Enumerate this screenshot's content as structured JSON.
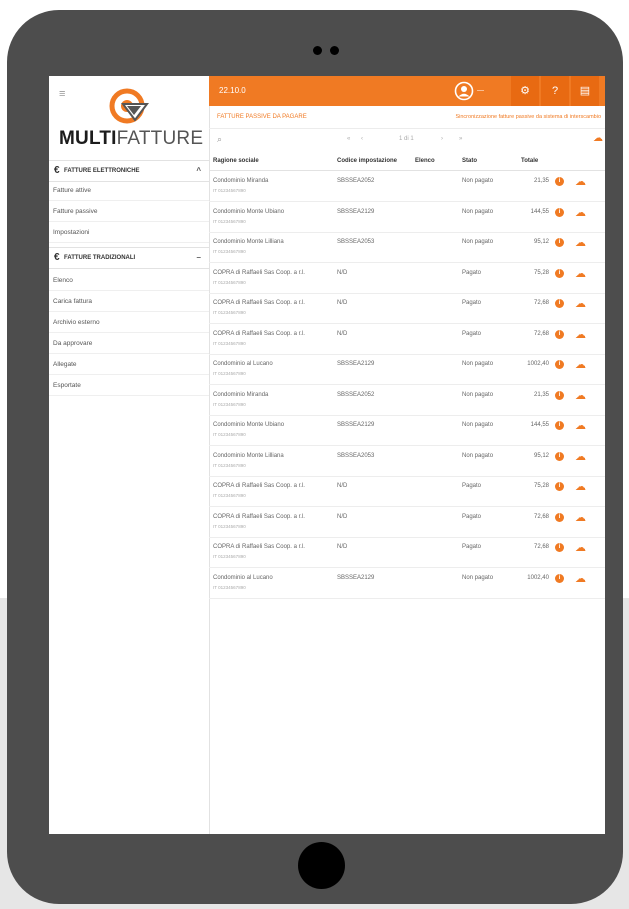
{
  "app": {
    "logo_bold": "MULTI",
    "logo_light": "FATTURE",
    "title": "22.10.0",
    "user": "—",
    "colors": {
      "accent": "#f07a23",
      "accent_dark": "#e86a12",
      "frame": "#4d4d4d"
    }
  },
  "topbar": {
    "icons": [
      "user-circle-icon",
      "gear-icon",
      "help-icon",
      "document-icon"
    ],
    "settings_glyph": "⚙",
    "help_glyph": "?",
    "doc_glyph": "▤"
  },
  "sidebar": {
    "menu_glyph": "≡",
    "sections": [
      {
        "title": "FATTURE ELETTRONICHE",
        "items": [
          "Fatture attive",
          "Fatture passive",
          "Impostazioni"
        ]
      },
      {
        "title": "FATTURE TRADIZIONALI",
        "items": [
          "Elenco",
          "Carica fattura",
          "Archivio esterno",
          "Da approvare",
          "Allegate",
          "Esportate"
        ]
      }
    ]
  },
  "main": {
    "breadcrumb": "FATTURE PASSIVE DA PAGARE",
    "header_right": "Sincronizzazione fatture passive da sistema di interscambio",
    "search_glyph": "⌕",
    "pager": [
      "«",
      "‹",
      "1 di 1",
      "›",
      "»"
    ],
    "columns": [
      "Ragione sociale",
      "Codice impostazione",
      "Elenco",
      "Stato",
      "Totale"
    ],
    "rows": [
      {
        "name": "Condominio Miranda",
        "sub": "IT 01234567890",
        "code": "SBSSEA2052",
        "stato": "Non pagato",
        "tot": "21,35"
      },
      {
        "name": "Condominio Monte Ubiano",
        "sub": "IT 01234567890",
        "code": "SBSSEA2129",
        "stato": "Non pagato",
        "tot": "144,55"
      },
      {
        "name": "Condominio Monte Lilliana",
        "sub": "IT 01234567890",
        "code": "SBSSEA2053",
        "stato": "Non pagato",
        "tot": "95,12"
      },
      {
        "name": "COPRA di Raffaeli Sas Coop. a r.l.",
        "sub": "IT 01234567890",
        "code": "N/D",
        "stato": "Pagato",
        "tot": "75,28"
      },
      {
        "name": "COPRA di Raffaeli Sas Coop. a r.l.",
        "sub": "IT 01234567890",
        "code": "N/D",
        "stato": "Pagato",
        "tot": "72,68"
      },
      {
        "name": "COPRA di Raffaeli Sas Coop. a r.l.",
        "sub": "IT 01234567890",
        "code": "N/D",
        "stato": "Pagato",
        "tot": "72,68"
      },
      {
        "name": "Condominio al Lucano",
        "sub": "IT 01234567890",
        "code": "SBSSEA2129",
        "stato": "Non pagato",
        "tot": "1002,40"
      },
      {
        "name": "Condominio Miranda",
        "sub": "IT 01234567890",
        "code": "SBSSEA2052",
        "stato": "Non pagato",
        "tot": "21,35"
      },
      {
        "name": "Condominio Monte Ubiano",
        "sub": "IT 01234567890",
        "code": "SBSSEA2129",
        "stato": "Non pagato",
        "tot": "144,55"
      },
      {
        "name": "Condominio Monte Lilliana",
        "sub": "IT 01234567890",
        "code": "SBSSEA2053",
        "stato": "Non pagato",
        "tot": "95,12"
      },
      {
        "name": "COPRA di Raffaeli Sas Coop. a r.l.",
        "sub": "IT 01234567890",
        "code": "N/D",
        "stato": "Pagato",
        "tot": "75,28"
      },
      {
        "name": "COPRA di Raffaeli Sas Coop. a r.l.",
        "sub": "IT 01234567890",
        "code": "N/D",
        "stato": "Pagato",
        "tot": "72,68"
      },
      {
        "name": "COPRA di Raffaeli Sas Coop. a r.l.",
        "sub": "IT 01234567890",
        "code": "N/D",
        "stato": "Pagato",
        "tot": "72,68"
      },
      {
        "name": "Condominio al Lucano",
        "sub": "IT 01234567890",
        "code": "SBSSEA2129",
        "stato": "Non pagato",
        "tot": "1002,40"
      }
    ],
    "info_glyph": "i",
    "cloud_glyph": "☁"
  }
}
